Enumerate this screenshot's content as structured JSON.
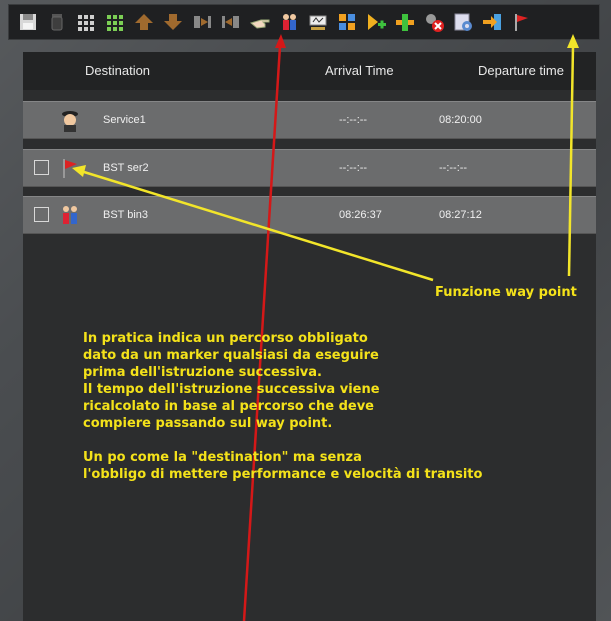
{
  "toolbar": {
    "icons": [
      "save-icon",
      "trash-icon",
      "grid-gray-icon",
      "grid-green-icon",
      "move-up-icon",
      "move-down-icon",
      "insert-before-icon",
      "insert-after-icon",
      "pointer-hand-icon",
      "passengers-icon",
      "sign-icon",
      "coupling-icon",
      "add-green-arrow-icon",
      "add-orange-icon",
      "remove-icon",
      "settings-icon",
      "exit-icon",
      "flag-icon"
    ]
  },
  "table": {
    "headers": {
      "destination": "Destination",
      "arrival": "Arrival Time",
      "departure": "Departure time"
    },
    "rows": [
      {
        "name": "Service1",
        "arrival": "--:--:--",
        "departure": "08:20:00",
        "icon": "driver-icon",
        "checkbox": false
      },
      {
        "name": "BST ser2",
        "arrival": "--:--:--",
        "departure": "--:--:--",
        "icon": "flag-icon",
        "checkbox": true
      },
      {
        "name": "BST bin3",
        "arrival": "08:26:37",
        "departure": "08:27:12",
        "icon": "passengers-icon",
        "checkbox": true
      }
    ]
  },
  "annotations": {
    "label": "Funzione way point",
    "body": "In pratica indica un percorso obbligato\ndato da un marker qualsiasi da eseguire\nprima dell'istruzione successiva.\nIl tempo dell'istruzione successiva viene\nricalcolato in base al percorso che deve\ncompiere passando sul way point.\n\nUn po come la \"destination\" ma senza\nl'obbligo di mettere performance e velocità di transito",
    "text_color": "#f4e21a",
    "arrow_red": "#d41818",
    "arrow_yellow": "#f2e52a"
  }
}
